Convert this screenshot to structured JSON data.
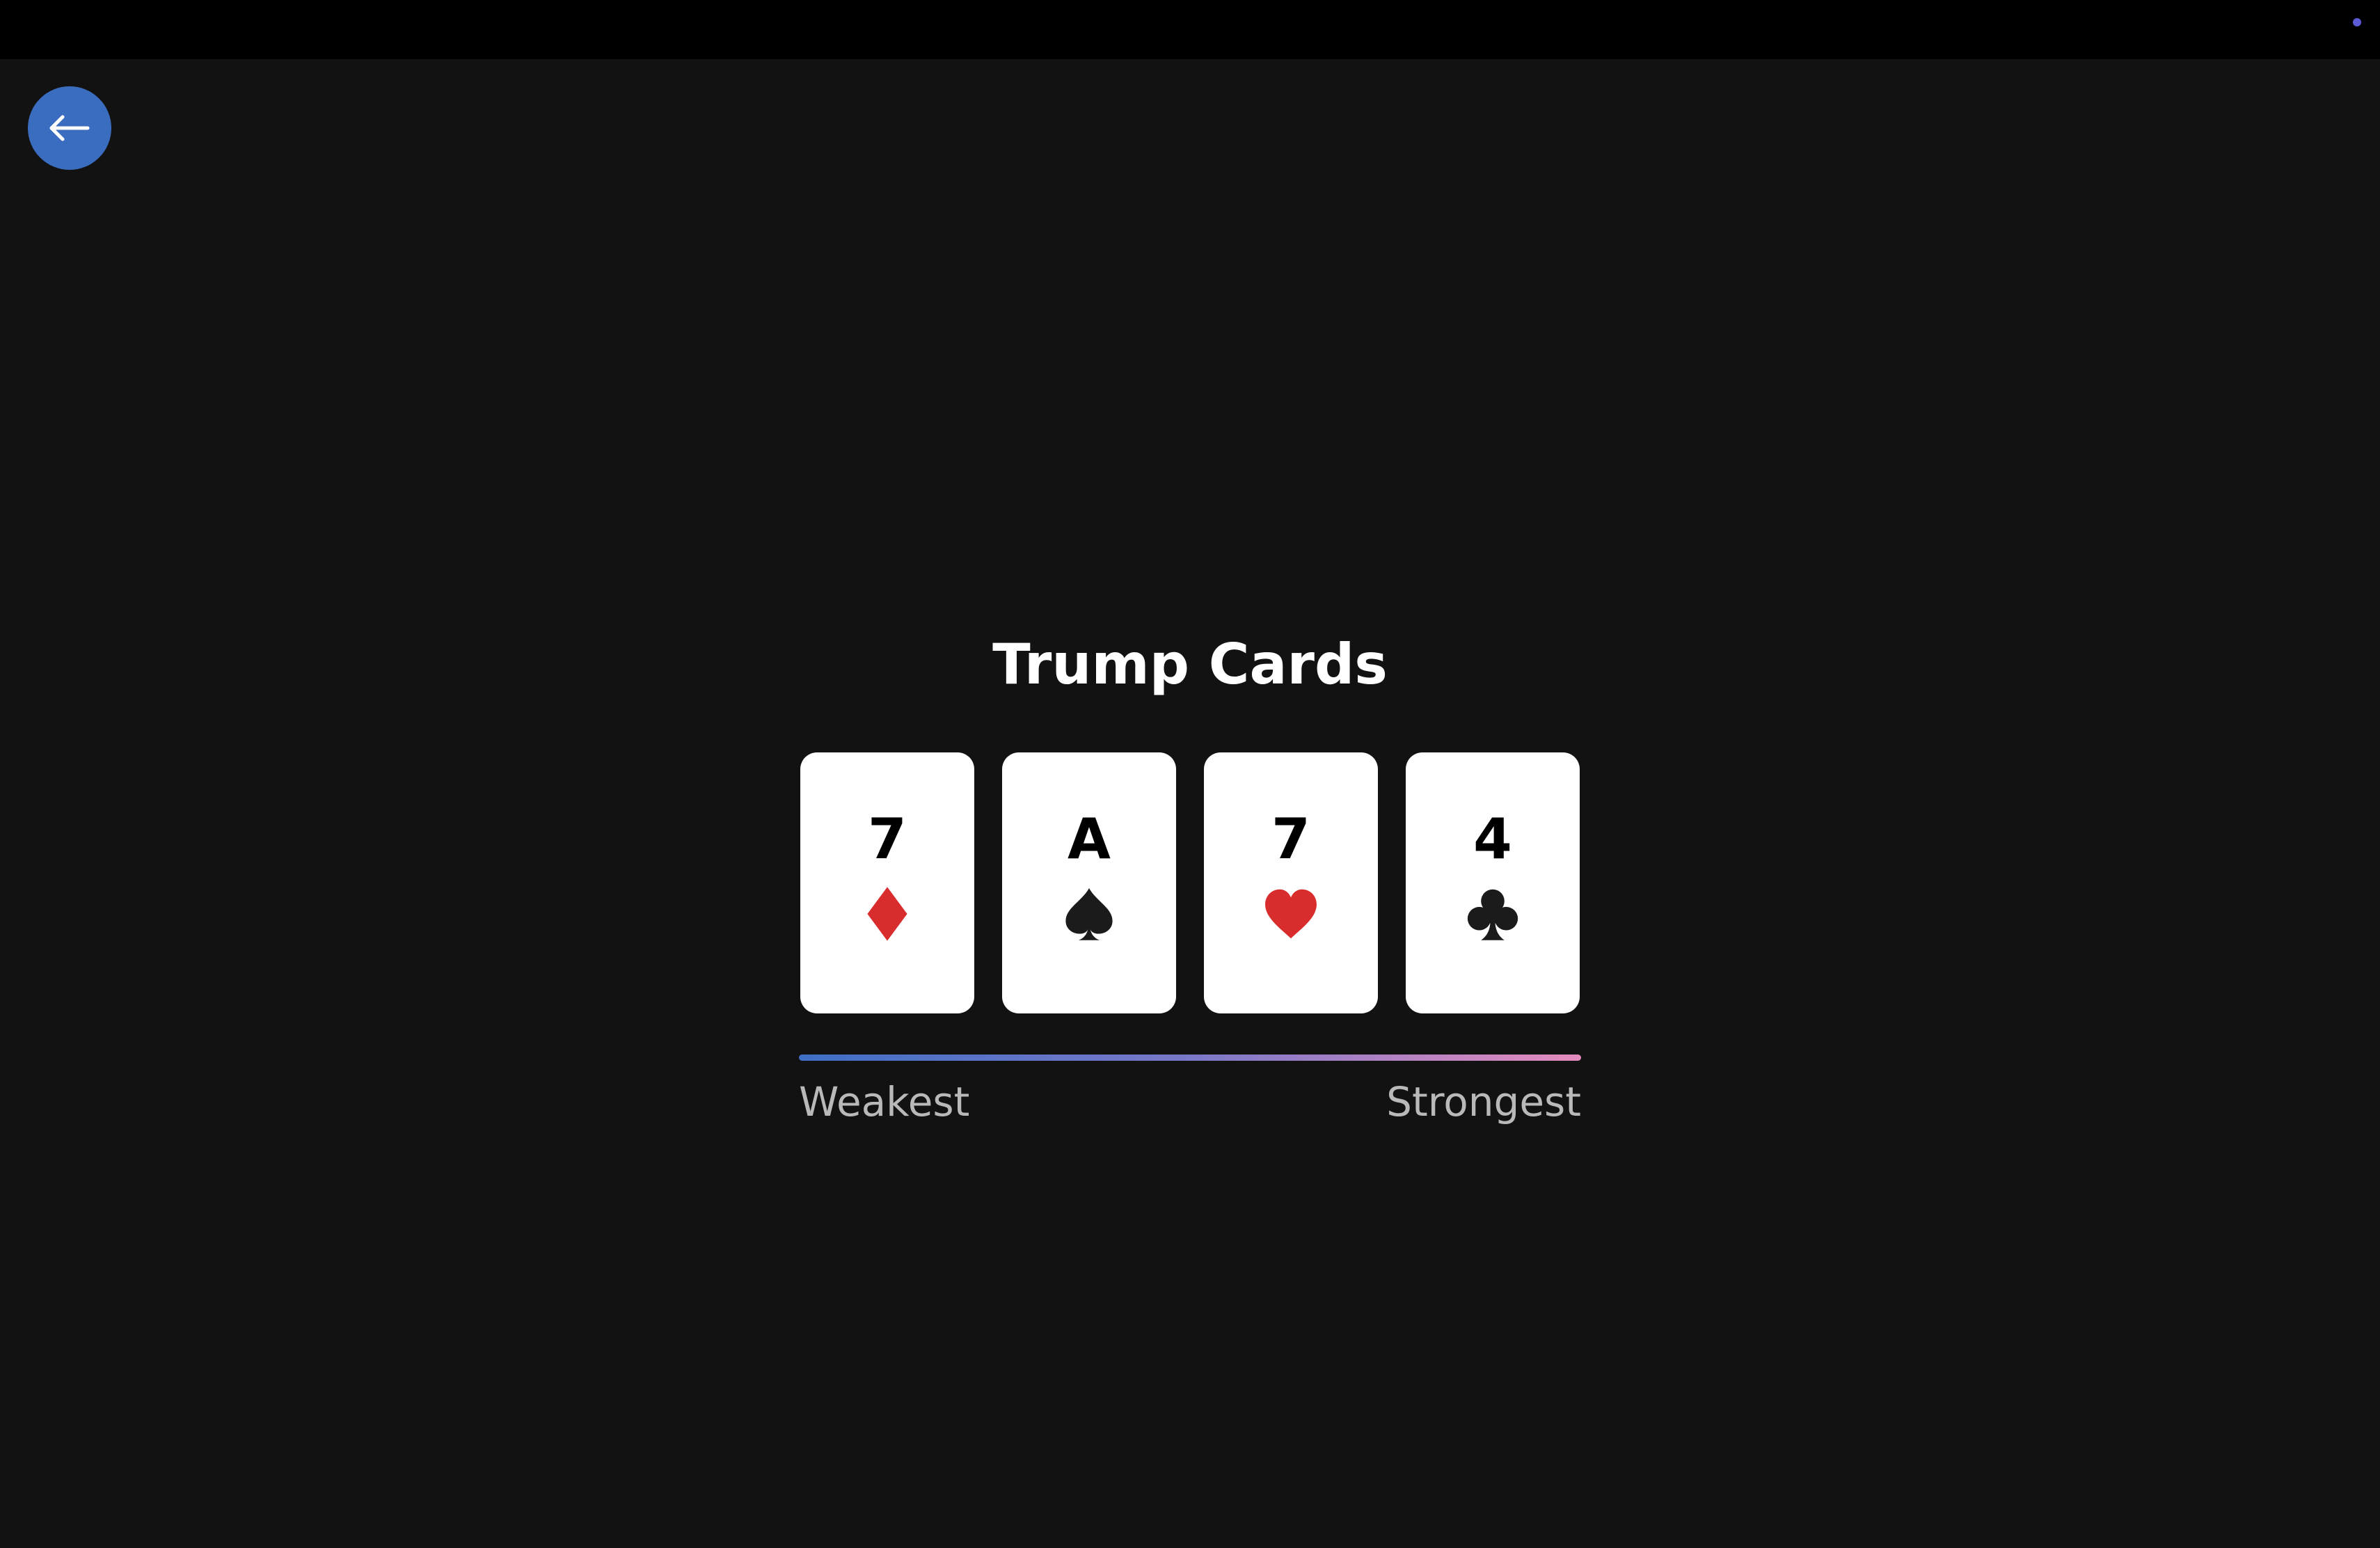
{
  "nav": {
    "back_icon": "arrow-left-icon"
  },
  "title": "Trump Cards",
  "cards": [
    {
      "rank": "7",
      "suit": "diamonds",
      "suit_color": "#d92d2d"
    },
    {
      "rank": "A",
      "suit": "spades",
      "suit_color": "#1b1b1b"
    },
    {
      "rank": "7",
      "suit": "hearts",
      "suit_color": "#d92d2d"
    },
    {
      "rank": "4",
      "suit": "clubs",
      "suit_color": "#1b1b1b"
    }
  ],
  "strength": {
    "weak_label": "Weakest",
    "strong_label": "Strongest",
    "gradient_colors": [
      "#3f6fc6",
      "#e58bbd"
    ]
  },
  "colors": {
    "background": "#121212",
    "topbar": "#000000",
    "back_button": "#3a6dbf",
    "status_dot": "#5b5bd6"
  }
}
